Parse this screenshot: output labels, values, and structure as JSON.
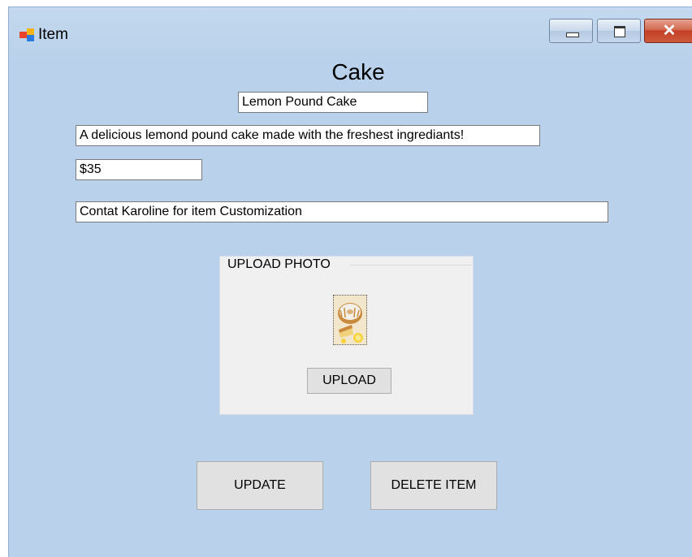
{
  "window": {
    "title": "Item",
    "controls": {
      "minimize_icon": "minimize-icon",
      "maximize_icon": "maximize-icon",
      "close_icon": "close-icon",
      "close_glyph": "✕"
    }
  },
  "form": {
    "heading": "Cake",
    "name_value": "Lemon Pound Cake",
    "description_value": "A delicious lemond pound cake made with the freshest ingrediants!",
    "price_value": "$35",
    "note_value": "Contat Karoline for item Customization"
  },
  "photo_group": {
    "label": "UPLOAD PHOTO",
    "upload_label": "UPLOAD"
  },
  "actions": {
    "update_label": "UPDATE",
    "delete_label": "DELETE ITEM"
  },
  "colors": {
    "form_background": "#b9d1ea",
    "close_button": "#c43f25",
    "group_background": "#f0f0f0"
  }
}
